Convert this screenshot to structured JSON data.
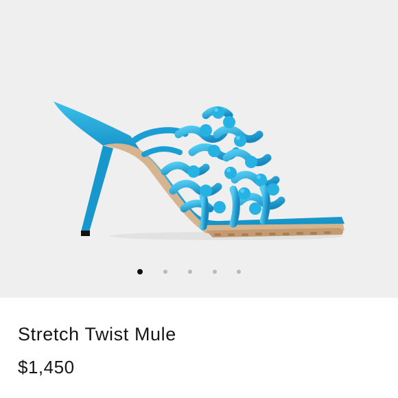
{
  "product": {
    "name": "Stretch Twist Mule",
    "price": "$1,450",
    "image_subject": "sandal-illustration",
    "color": "#1aa3d6"
  },
  "carousel": {
    "total": 5,
    "active_index": 0
  },
  "colors": {
    "gallery_background": "#efefef",
    "sole": "#c9a27e",
    "dot_active": "#111111",
    "dot_inactive": "#b9b9b9"
  }
}
